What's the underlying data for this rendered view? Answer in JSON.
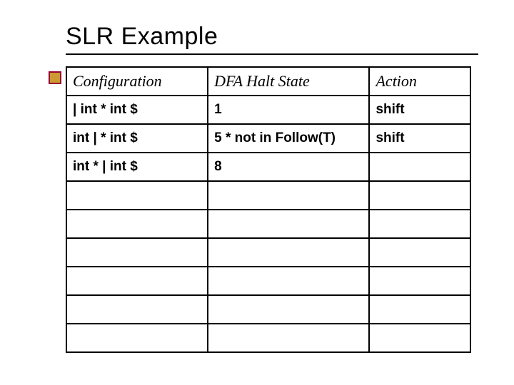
{
  "title": "SLR Example",
  "table": {
    "headers": {
      "configuration": "Configuration",
      "dfa_halt_state": "DFA Halt State",
      "action": "Action"
    },
    "rows": [
      {
        "configuration": "| int * int $",
        "dfa_halt_state": "1",
        "action": "shift"
      },
      {
        "configuration": "int | * int $",
        "dfa_halt_state": "5   * not in Follow(T)",
        "action": "shift"
      },
      {
        "configuration": "int * | int $",
        "dfa_halt_state": "8",
        "action": ""
      },
      {
        "configuration": "",
        "dfa_halt_state": "",
        "action": ""
      },
      {
        "configuration": "",
        "dfa_halt_state": "",
        "action": ""
      },
      {
        "configuration": "",
        "dfa_halt_state": "",
        "action": ""
      },
      {
        "configuration": "",
        "dfa_halt_state": "",
        "action": ""
      },
      {
        "configuration": "",
        "dfa_halt_state": "",
        "action": ""
      },
      {
        "configuration": "",
        "dfa_halt_state": "",
        "action": ""
      }
    ]
  }
}
